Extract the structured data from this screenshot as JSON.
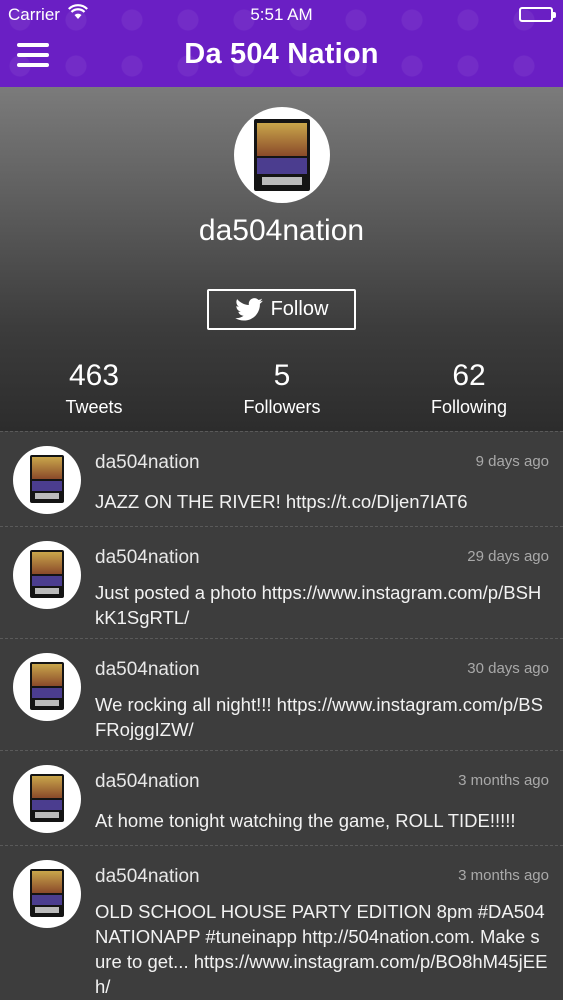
{
  "status_bar": {
    "carrier": "Carrier",
    "time": "5:51 AM"
  },
  "header": {
    "title": "Da 504 Nation",
    "menu_icon": "hamburger-menu-icon",
    "accent_color": "#6a1fc4"
  },
  "profile": {
    "username": "da504nation",
    "follow_label": "Follow",
    "stats": {
      "tweets": {
        "value": "463",
        "label": "Tweets"
      },
      "followers": {
        "value": "5",
        "label": "Followers"
      },
      "following": {
        "value": "62",
        "label": "Following"
      }
    }
  },
  "tweets": [
    {
      "user": "da504nation",
      "time": "9 days ago",
      "text": "JAZZ ON THE RIVER! https://t.co/DIjen7IAT6"
    },
    {
      "user": "da504nation",
      "time": "29 days ago",
      "text": "Just posted a photo https://www.instagram.com/p/BSHkK1SgRTL/"
    },
    {
      "user": "da504nation",
      "time": "30 days ago",
      "text": "We rocking all night!!! https://www.instagram.com/p/BSFRojggIZW/"
    },
    {
      "user": "da504nation",
      "time": "3 months ago",
      "text": "At home tonight watching the game, ROLL TIDE!!!!!"
    },
    {
      "user": "da504nation",
      "time": "3 months ago",
      "text": "OLD SCHOOL HOUSE PARTY EDITION 8pm #DA504NATIONAPP #tuneinapp http://504nation.com. Make sure to get... https://www.instagram.com/p/BO8hM45jEEh/"
    }
  ]
}
